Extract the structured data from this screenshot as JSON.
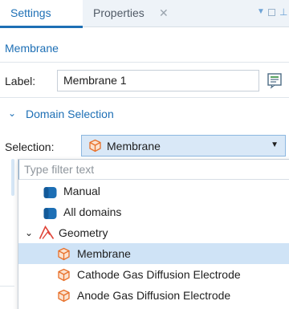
{
  "tabs": {
    "settings": "Settings",
    "properties": "Properties",
    "close_glyph": "✕"
  },
  "window_controls": {
    "menu": "▼",
    "pin": "⊥"
  },
  "node": {
    "heading": "Membrane"
  },
  "label_field": {
    "label": "Label:",
    "value": "Membrane 1"
  },
  "domain_section": {
    "chevron": "⌄",
    "title": "Domain Selection"
  },
  "selection": {
    "label": "Selection:",
    "value": "Membrane",
    "arrow": "▼",
    "filter_placeholder": "Type filter text",
    "options": [
      {
        "label": "Manual",
        "icon": "selection-group-icon"
      },
      {
        "label": "All domains",
        "icon": "selection-group-icon"
      },
      {
        "label": "Geometry",
        "icon": "geometry-icon",
        "expand": "⌄"
      },
      {
        "label": "Membrane",
        "icon": "domain-box-icon",
        "selected": true
      },
      {
        "label": "Cathode Gas Diffusion Electrode",
        "icon": "domain-box-icon"
      },
      {
        "label": "Anode Gas Diffusion Electrode",
        "icon": "domain-box-icon"
      }
    ]
  },
  "colors": {
    "accent": "#1d6fb5",
    "selection_bg": "#cfe3f6",
    "combo_bg": "#d9e8f7",
    "domain_icon": "#e8702a"
  }
}
